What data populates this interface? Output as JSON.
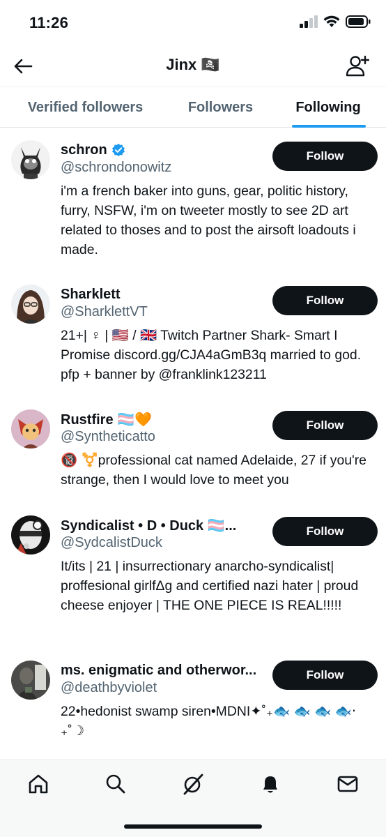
{
  "status_bar": {
    "time": "11:26"
  },
  "header": {
    "title": "Jinx 🏴‍☠️"
  },
  "tabs": [
    {
      "label": "Verified followers"
    },
    {
      "label": "Followers"
    },
    {
      "label": "Following"
    }
  ],
  "accent_color": "#1d9bf0",
  "users": [
    {
      "name": "schron",
      "verified": true,
      "handle": "@schrondonowitz",
      "bio": "i'm a french baker into guns, gear, politic history, furry, NSFW, i'm on tweeter mostly to see 2D art related to thoses and to post the airsoft loadouts i made.",
      "button": "Follow"
    },
    {
      "name": "Sharklett",
      "handle": "@SharklettVT",
      "bio": "21+| ♀ | 🇺🇸 / 🇬🇧 Twitch Partner Shark- Smart I Promise discord.gg/CJA4aGmB3q married to god. pfp + banner by @franklink123211",
      "button": "Follow"
    },
    {
      "name": "Rustfire 🏳️‍⚧️🧡",
      "handle": "@Syntheticatto",
      "bio": "🔞 ⚧️professional cat named Adelaide, 27 if you're strange, then I would love to meet you",
      "button": "Follow"
    },
    {
      "name": "Syndicalist • D • Duck 🏳️‍⚧️...",
      "handle": "@SydcalistDuck",
      "bio": "It/its | 21 | insurrectionary anarcho-syndicalist| proffesional girlfΔg and certified nazi hater | proud cheese enjoyer | THE ONE PIECE IS REAL!!!!!",
      "button": "Follow"
    },
    {
      "name": "ms. enigmatic and otherwor...",
      "handle": "@deathbyviolet",
      "bio": "22•hedonist swamp siren•MDNI✦˚₊🐟 🐟 🐟 🐟‧₊˚☽",
      "button": "Follow"
    }
  ],
  "bottom_nav": [
    {
      "icon": "home-icon"
    },
    {
      "icon": "search-icon"
    },
    {
      "icon": "grok-icon"
    },
    {
      "icon": "bell-icon"
    },
    {
      "icon": "mail-icon"
    }
  ]
}
